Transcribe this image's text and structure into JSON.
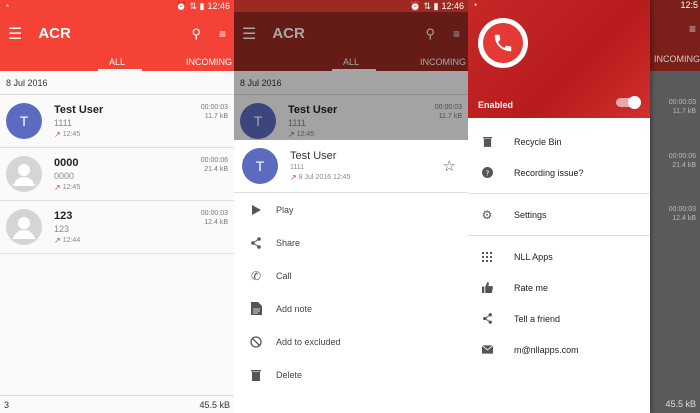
{
  "status": {
    "time1": "12:46",
    "time2": "12:46",
    "time3": "12:5"
  },
  "app": {
    "title": "ACR"
  },
  "tabs": {
    "all": "ALL",
    "incoming": "INCOMING",
    "incoming_partial": "INCOMING"
  },
  "date_header": "8 Jul 2016",
  "recordings": [
    {
      "initial": "T",
      "name": "Test User",
      "number": "1111",
      "time": "12:45",
      "duration": "00:00:03",
      "size": "11.7 kB"
    },
    {
      "initial": "",
      "name": "0000",
      "number": "0000",
      "time": "12:45",
      "duration": "00:00:06",
      "size": "21.4 kB"
    },
    {
      "initial": "",
      "name": "123",
      "number": "123",
      "time": "12:44",
      "duration": "00:00:03",
      "size": "12.4 kB"
    }
  ],
  "footer": {
    "count": "3",
    "total_size": "45.5 kB"
  },
  "sheet": {
    "initial": "T",
    "name": "Test User",
    "number": "1111",
    "datetime": "8 Jul 2016 12:45",
    "items": [
      "Play",
      "Share",
      "Call",
      "Add note",
      "Add to excluded",
      "Delete"
    ]
  },
  "drawer": {
    "enabled_label": "Enabled",
    "items_group1": [
      "Recycle Bin",
      "Recording issue?"
    ],
    "items_group2": [
      "Settings"
    ],
    "items_group3": [
      "NLL Apps",
      "Rate me",
      "Tell a friend",
      "m@nllapps.com"
    ]
  },
  "colors": {
    "accent": "#f44336",
    "dark_accent": "#9c2a22",
    "avatar_blue": "#5c6bc0"
  }
}
